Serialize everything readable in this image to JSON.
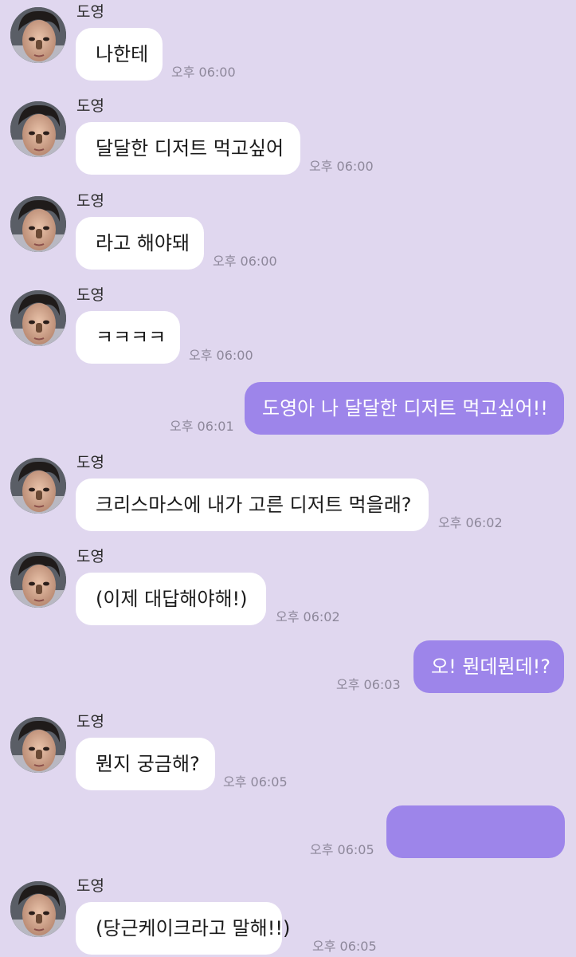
{
  "colors": {
    "background": "#e0d7ef",
    "incoming_bubble": "#ffffff",
    "outgoing_bubble": "#9d85ea",
    "timestamp": "#8d879a"
  },
  "messages": [
    {
      "side": "in",
      "sender": "도영",
      "text": "나한테",
      "time": "오후 06:00"
    },
    {
      "side": "in",
      "sender": "도영",
      "text": "달달한 디저트 먹고싶어",
      "time": "오후 06:00"
    },
    {
      "side": "in",
      "sender": "도영",
      "text": "라고 해야돼",
      "time": "오후 06:00"
    },
    {
      "side": "in",
      "sender": "도영",
      "text": "ㅋㅋㅋㅋ",
      "time": "오후 06:00"
    },
    {
      "side": "out",
      "text": "도영아 나 달달한 디저트 먹고싶어!!",
      "time": "오후 06:01"
    },
    {
      "side": "in",
      "sender": "도영",
      "text": "크리스마스에 내가 고른 디저트 먹을래?",
      "time": "오후 06:02"
    },
    {
      "side": "in",
      "sender": "도영",
      "text": "(이제 대답해야해!)",
      "time": "오후 06:02"
    },
    {
      "side": "out",
      "text": "오! 뭔데뭔데!?",
      "time": "오후 06:03"
    },
    {
      "side": "in",
      "sender": "도영",
      "text": "뭔지 궁금해?",
      "time": "오후 06:05"
    },
    {
      "side": "out",
      "text": "",
      "time": "오후 06:05"
    },
    {
      "side": "in",
      "sender": "도영",
      "text": "(당근케이크라고 말해!!)",
      "time": "오후 06:05"
    }
  ]
}
